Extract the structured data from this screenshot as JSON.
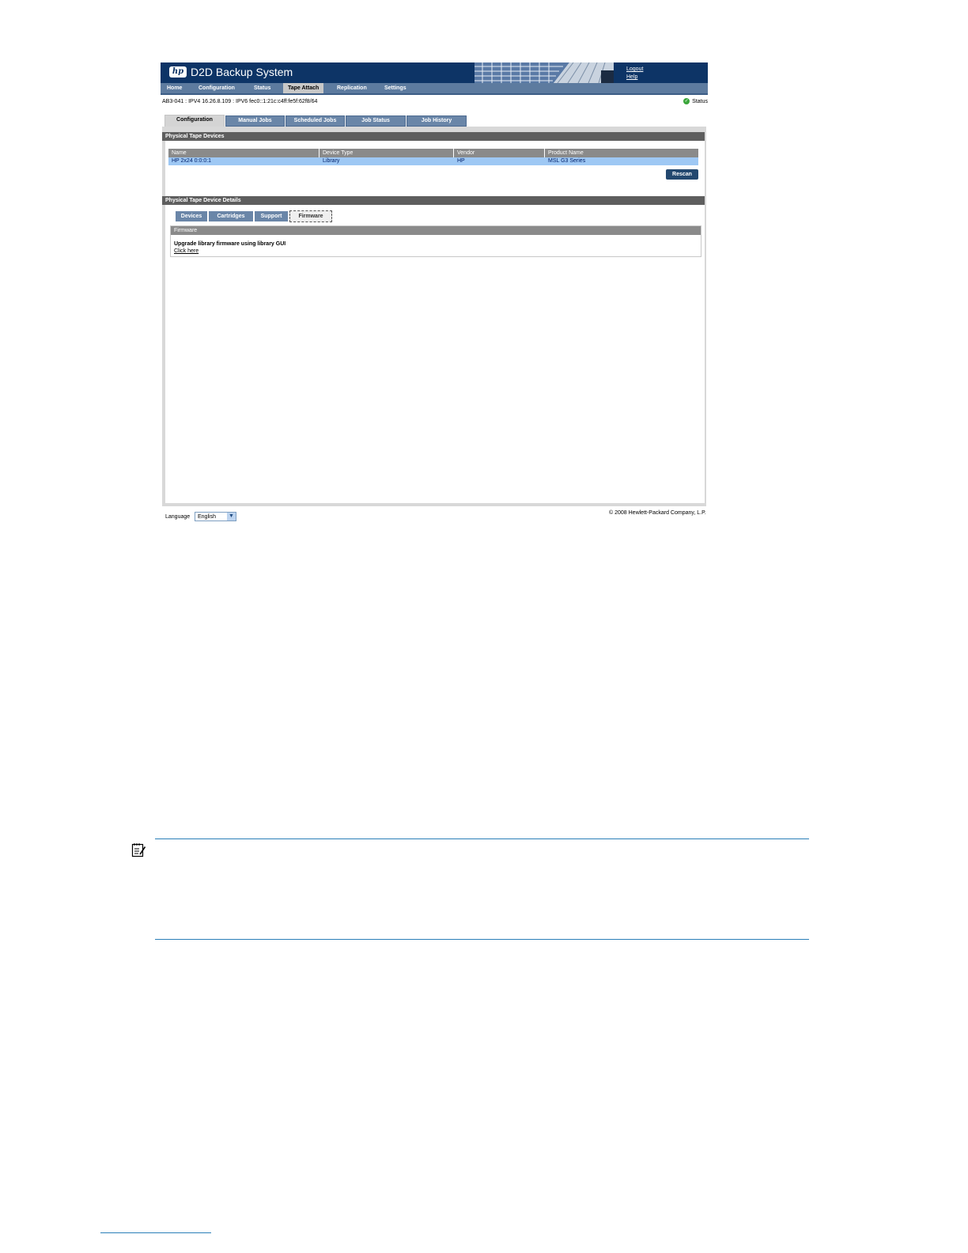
{
  "app": {
    "title": "D2D Backup System",
    "logo_text": "hp"
  },
  "header_links": {
    "logout": "Logout",
    "help": "Help"
  },
  "main_nav": [
    "Home",
    "Configuration",
    "Status",
    "Tape Attach",
    "Replication",
    "Settings"
  ],
  "main_nav_active": "Tape Attach",
  "address_line": "AB3-041 : IPV4 16.26.8.109 : IPV6 fec0::1:21c:c4ff:fe5f:62f8/64",
  "status_label": "Status",
  "tabs": [
    "Configuration",
    "Manual Jobs",
    "Scheduled Jobs",
    "Job Status",
    "Job History"
  ],
  "tabs_active": "Configuration",
  "physical_devices": {
    "title": "Physical Tape Devices",
    "columns": [
      "Name",
      "Device Type",
      "Vendor",
      "Product Name"
    ],
    "rows": [
      [
        "HP 2x24 0:0:0:1",
        "Library",
        "HP",
        "MSL G3 Series"
      ]
    ],
    "rescan_label": "Rescan"
  },
  "device_details": {
    "title": "Physical Tape Device Details",
    "subtabs": [
      "Devices",
      "Cartridges",
      "Support",
      "Firmware"
    ],
    "subtabs_active": "Firmware",
    "firmware": {
      "header": "Firmware",
      "text": "Upgrade library firmware using library GUI",
      "link": "Click here"
    }
  },
  "language": {
    "label": "Language",
    "value": "English"
  },
  "copyright": "© 2008 Hewlett-Packard Company, L.P.",
  "colors": {
    "banner": "#0d3466",
    "nav": "#5d7b9f",
    "tab": "#6a86a8",
    "section_header": "#5e5e5e",
    "table_header": "#8a8a8a",
    "selected_row": "#9ec8f4",
    "note_rule": "#2a7fb8"
  },
  "icons": {
    "status": "check-circle-icon",
    "note": "note-pad-icon",
    "dropdown": "chevron-down-icon"
  }
}
